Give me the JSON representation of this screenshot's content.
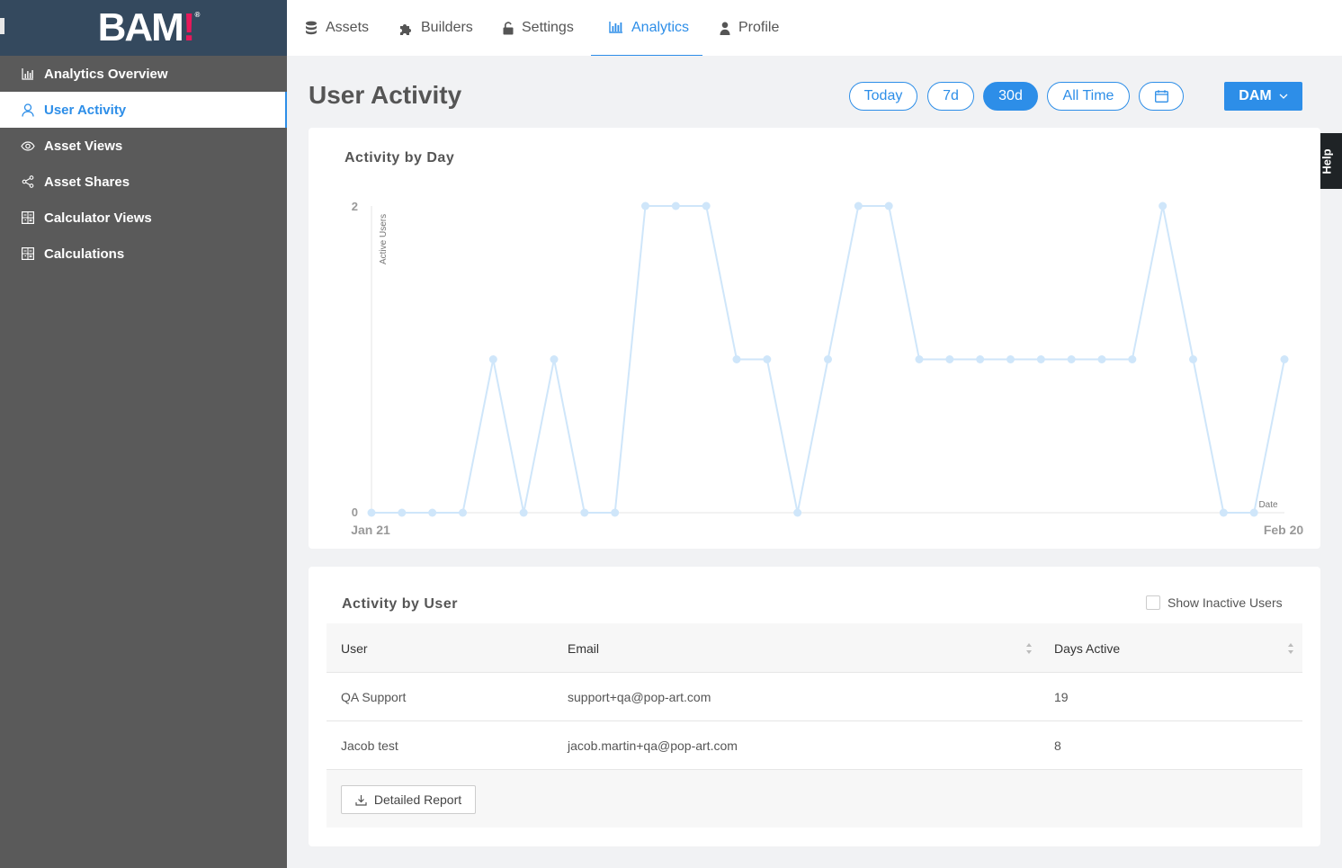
{
  "brand": {
    "logo_text": "BAM",
    "logo_mark": "!",
    "logo_reg": "®",
    "logo_color": "#e8185a"
  },
  "sidebar": {
    "items": [
      {
        "label": "Analytics Overview",
        "icon": "bar-chart-icon"
      },
      {
        "label": "User Activity",
        "icon": "user-icon",
        "active": true
      },
      {
        "label": "Asset Views",
        "icon": "eye-icon"
      },
      {
        "label": "Asset Shares",
        "icon": "share-icon"
      },
      {
        "label": "Calculator Views",
        "icon": "calculator-icon"
      },
      {
        "label": "Calculations",
        "icon": "calculator-icon"
      }
    ]
  },
  "tabs": [
    {
      "label": "Assets",
      "icon": "database-icon"
    },
    {
      "label": "Builders",
      "icon": "puzzle-icon"
    },
    {
      "label": "Settings",
      "icon": "lock-icon"
    },
    {
      "label": "Analytics",
      "icon": "bar-chart-icon",
      "active": true
    },
    {
      "label": "Profile",
      "icon": "person-icon"
    }
  ],
  "header": {
    "title": "User Activity",
    "ranges": [
      {
        "label": "Today"
      },
      {
        "label": "7d"
      },
      {
        "label": "30d",
        "active": true
      },
      {
        "label": "All Time"
      }
    ],
    "calendar_icon": "calendar-icon",
    "dropdown_label": "DAM"
  },
  "help_label": "Help",
  "activity_by_day": {
    "title": "Activity by Day",
    "chart_data": {
      "type": "line",
      "title": "Activity by Day",
      "xlabel": "Date",
      "ylabel": "Active Users",
      "x_start_label": "Jan 21",
      "x_end_label": "Feb 20",
      "y_ticks": [
        "0",
        "2"
      ],
      "ylim": [
        0,
        2
      ],
      "grid": false,
      "series": [
        {
          "values": [
            0,
            0,
            0,
            0,
            1,
            0,
            1,
            0,
            0,
            2,
            2,
            2,
            1,
            1,
            0,
            1,
            2,
            2,
            1,
            1,
            1,
            1,
            1,
            1,
            1,
            1,
            2,
            1,
            0,
            0,
            1
          ]
        }
      ],
      "color": "#cfe6fa"
    }
  },
  "activity_by_user": {
    "title": "Activity by User",
    "show_inactive_label": "Show Inactive Users",
    "columns": [
      "User",
      "Email",
      "Days Active"
    ],
    "rows": [
      {
        "user": "QA Support",
        "email": "support+qa@pop-art.com",
        "days": "19"
      },
      {
        "user": "Jacob test",
        "email": "jacob.martin+qa@pop-art.com",
        "days": "8"
      }
    ],
    "report_button": "Detailed Report"
  },
  "accent_color": "#2d8ee8"
}
